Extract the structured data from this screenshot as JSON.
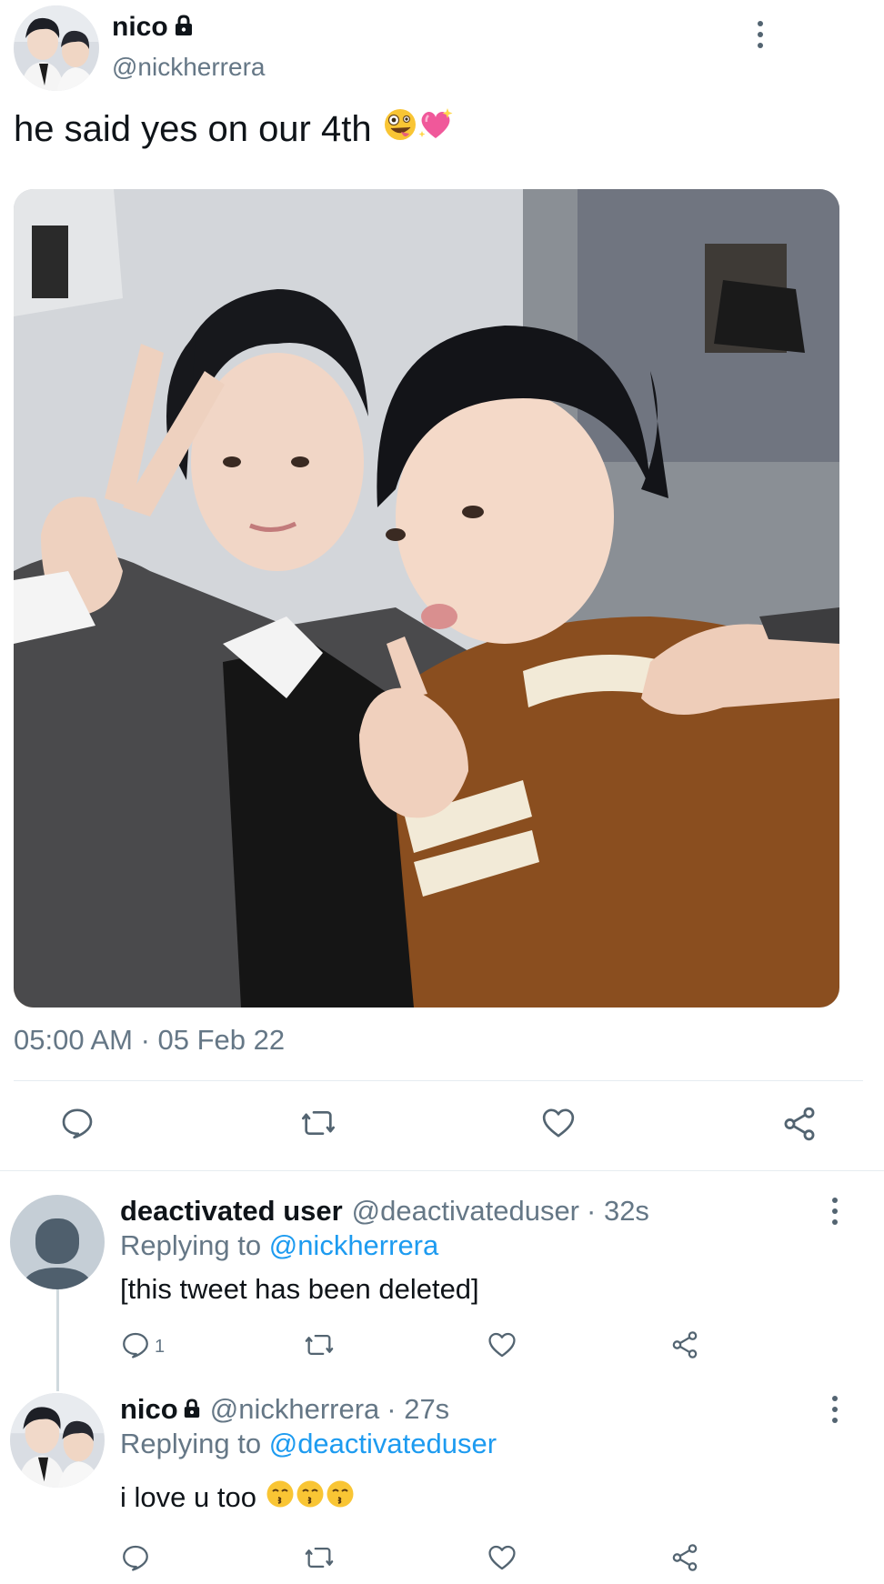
{
  "tweet": {
    "display_name": "nico",
    "handle": "@nickherrera",
    "text": "he said yes on our 4th",
    "emojis": [
      "zany-face",
      "sparkling-heart"
    ],
    "timestamp": "05:00 AM · 05 Feb 22"
  },
  "replies": [
    {
      "display_name": "deactivated user",
      "handle": "@deactivateduser",
      "time": "· 32s",
      "replying_label": "Replying to",
      "replying_to": "@nickherrera",
      "text": "[this tweet has been deleted]",
      "reply_count": "1"
    },
    {
      "display_name": "nico",
      "handle": "@nickherrera",
      "time": "· 27s",
      "replying_label": "Replying to",
      "replying_to": "@deactivateduser",
      "text": "i love u too",
      "emojis": [
        "kissing-face",
        "kissing-face",
        "kissing-face"
      ]
    }
  ],
  "colors": {
    "link": "#1d9bf0",
    "muted": "#657786",
    "icon": "#536471"
  }
}
